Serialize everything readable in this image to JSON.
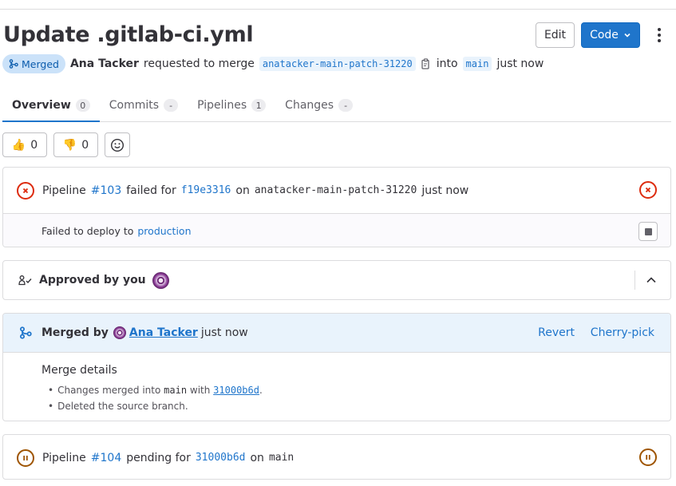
{
  "mr": {
    "title": "Update .gitlab-ci.yml",
    "status": "Merged",
    "author": "Ana Tacker",
    "requested_text": "requested to merge",
    "source_branch": "anatacker-main-patch-31220",
    "into_text": "into",
    "target_branch": "main",
    "time": "just now"
  },
  "actions": {
    "edit_label": "Edit",
    "code_label": "Code"
  },
  "tabs": [
    {
      "label": "Overview",
      "count": "0"
    },
    {
      "label": "Commits",
      "count": "-"
    },
    {
      "label": "Pipelines",
      "count": "1"
    },
    {
      "label": "Changes",
      "count": "-"
    }
  ],
  "reactions": {
    "thumbs_up": "0",
    "thumbs_down": "0"
  },
  "pipeline": {
    "prefix": "Pipeline",
    "id": "#103",
    "status_text": "failed for",
    "commit": "f19e3316",
    "on_text": "on",
    "branch": "anatacker-main-patch-31220",
    "time": "just now",
    "deploy_text": "Failed to deploy to",
    "environment": "production"
  },
  "approval": {
    "text": "Approved by you"
  },
  "merged": {
    "by_text": "Merged by",
    "user": "Ana Tacker",
    "time": "just now",
    "revert_label": "Revert",
    "cherry_pick_label": "Cherry-pick",
    "details_title": "Merge details",
    "detail_1_prefix": "Changes merged into",
    "detail_1_branch": "main",
    "detail_1_with": "with",
    "detail_1_commit": "31000b6d",
    "detail_1_end": ".",
    "detail_2": "Deleted the source branch."
  },
  "pipeline2": {
    "prefix": "Pipeline",
    "id": "#104",
    "status_text": "pending for",
    "commit": "31000b6d",
    "on_text": "on",
    "branch": "main"
  },
  "colors": {
    "accent": "#1f75cb",
    "failed": "#dd2b0e",
    "pending": "#9e5400",
    "merged_badge_bg": "#cbe2f9",
    "merged_section_bg": "#e9f3fc"
  }
}
